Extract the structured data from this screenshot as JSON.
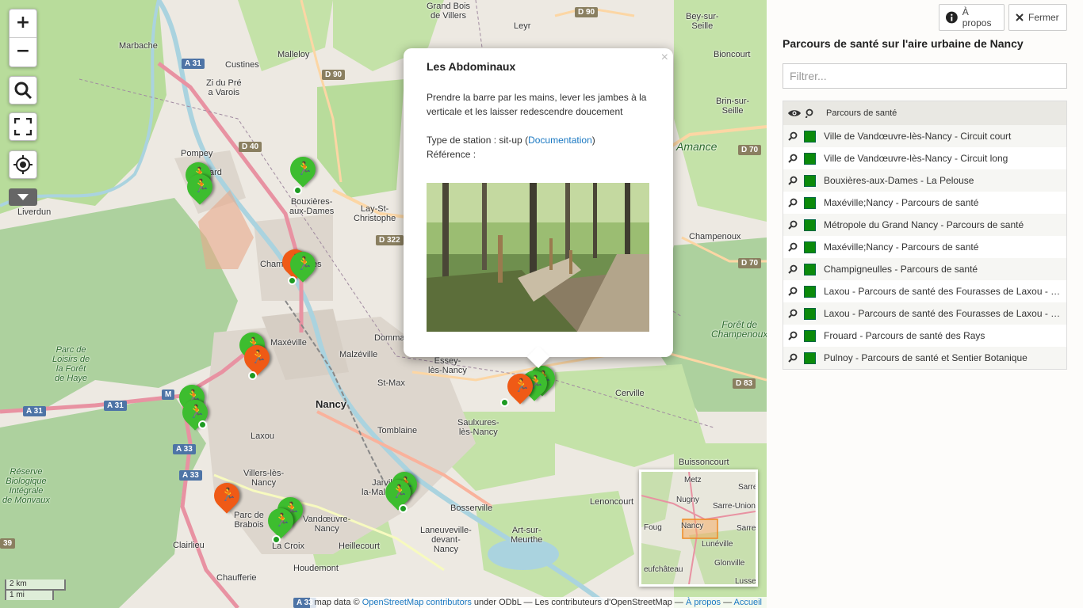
{
  "map": {
    "zoom_in": "+",
    "zoom_out": "−",
    "places": {
      "malleloy": "Malleloy",
      "custines": "Custines",
      "marbache": "Marbache",
      "pompey": "Pompey",
      "liverdun": "Liverdun",
      "bouxieres": "Bouxières-\naux-Dames",
      "lay": "Lay-St-\nChristophe",
      "champenoux": "Champenoux",
      "amance": "Amance",
      "maxeville": "Maxéville",
      "malzeville": "Malzéville",
      "essey": "Essey-\nlès-Nancy",
      "stmax": "St-Max",
      "nancy": "Nancy",
      "laxou": "Laxou",
      "tomblaine": "Tomblaine",
      "saulxures": "Saulxures-\nlès-Nancy",
      "cerville": "Cerville",
      "villers": "Villers-lès-\nNancy",
      "vandoeuvre": "Vandœuvre-\nNancy",
      "jarville": "Jarville-\nla-Malgrange",
      "buissoncourt": "Buissoncourt",
      "leoncourt": "Lenoncourt",
      "artsur": "Art-sur-\nMeurthe",
      "laneuveville": "Laneuveville-\ndevant-\nNancy",
      "heillecourt": "Heillecourt",
      "houdemont": "Houdemont",
      "chaufferie": "Chaufferie",
      "lacroix": "La Croix",
      "clairlieu": "Clairlieu",
      "foret": "Forêt de\nChampenoux",
      "parc": "Parc de\nLoisirs de\nla Forêt\nde Haye",
      "reserve": "Réserve\nBiologique\nIntégrale\nde Monvaux",
      "beyseille": "Bey-sur-\nSeille",
      "bioncourt": "Bioncourt",
      "brin": "Brin-sur-\nSeille",
      "leyr": "Leyr",
      "villers2": "Grand Bois\nde Villers",
      "bosserville": "Bosserville",
      "parcbrab": "Parc de\nBrabois",
      "dommartin": "Domma",
      "ard": "ard",
      "varois": "Zi du Pré\na Varois",
      "champ": "Cham",
      "es": "es"
    },
    "roads": {
      "a31_1": "A 31",
      "a31_2": "A 31",
      "a31_3": "A 31",
      "a33_1": "A 33",
      "a33_2": "A 33",
      "a33_3": "A 33",
      "d90a": "D 90",
      "d90b": "D 90",
      "d40": "D 40",
      "d322": "D 322",
      "d70a": "D 70",
      "d70b": "D 70",
      "d83": "D 83",
      "m": "M",
      "n": "39"
    },
    "scale_km": "2 km",
    "scale_mi": "1 mi",
    "attribution": {
      "prefix": "map data © ",
      "osm_link": "OpenStreetMap contributors",
      "middle": " under ODbL — Les contributeurs d'OpenStreetMap — ",
      "apropos": "À propos",
      "sep": " — ",
      "accueil": "Accueil"
    },
    "minimap": {
      "metz": "Metz",
      "sarreg": "Sarreg",
      "nugny": "Nugny",
      "sarre_union": "Sarre-Union",
      "foug": "Foug",
      "nancy": "Nancy",
      "sarre": "Sarre",
      "luneville": "Lunéville",
      "eufchateau": "eufchâteau",
      "glonville": "Glonville",
      "lusse": "Lusse"
    }
  },
  "popup": {
    "title": "Les Abdominaux",
    "description": "Prendre la barre par les mains, lever les jambes à la verticale et les laisser redescendre doucement",
    "type_prefix": "Type de station : sit-up (",
    "type_link": "Documentation",
    "type_suffix": ")",
    "reference": "Référence :",
    "close": "×"
  },
  "panel": {
    "apropos_label": "À propos",
    "close_label": "Fermer",
    "title": "Parcours de santé sur l'aire urbaine de Nancy",
    "filter_placeholder": "Filtrer...",
    "layer_group": "Parcours de santé",
    "layers": [
      "Ville de Vandœuvre-lès-Nancy - Circuit court",
      "Ville de Vandœuvre-lès-Nancy - Circuit long",
      "Bouxières-aux-Dames - La Pelouse",
      "Maxéville;Nancy - Parcours de santé",
      "Métropole du Grand Nancy - Parcours de santé",
      "Maxéville;Nancy - Parcours de santé",
      "Champigneulles - Parcours de santé",
      "Laxou - Parcours de santé des Fourasses de Laxou - Circuit",
      "Laxou - Parcours de santé des Fourasses de Laxou - Circuit",
      "Frouard - Parcours de santé des Rays",
      "Pulnoy - Parcours de santé et Sentier Botanique"
    ],
    "layer_color": "#0b8a0b"
  }
}
